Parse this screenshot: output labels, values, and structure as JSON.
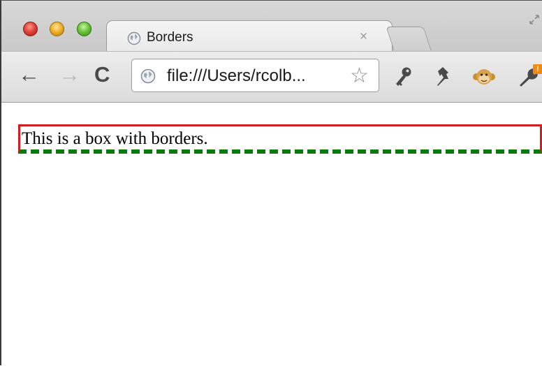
{
  "browser": {
    "tab": {
      "title": "Borders",
      "close_glyph": "×",
      "favicon": "globe-icon"
    },
    "toolbar": {
      "back_glyph": "←",
      "forward_glyph": "→",
      "reload_glyph": "C",
      "url": "file:///Users/rcolb...",
      "star_glyph": "☆",
      "extension_icons": [
        "key-icon",
        "pin-icon",
        "monkey-icon",
        "wrench-icon"
      ],
      "wrench_badge": "!"
    }
  },
  "page": {
    "box_text": "This is a box with borders.",
    "colors": {
      "border_red": "#cc1f1f",
      "border_green_dashed": "#0a7a0a"
    }
  }
}
